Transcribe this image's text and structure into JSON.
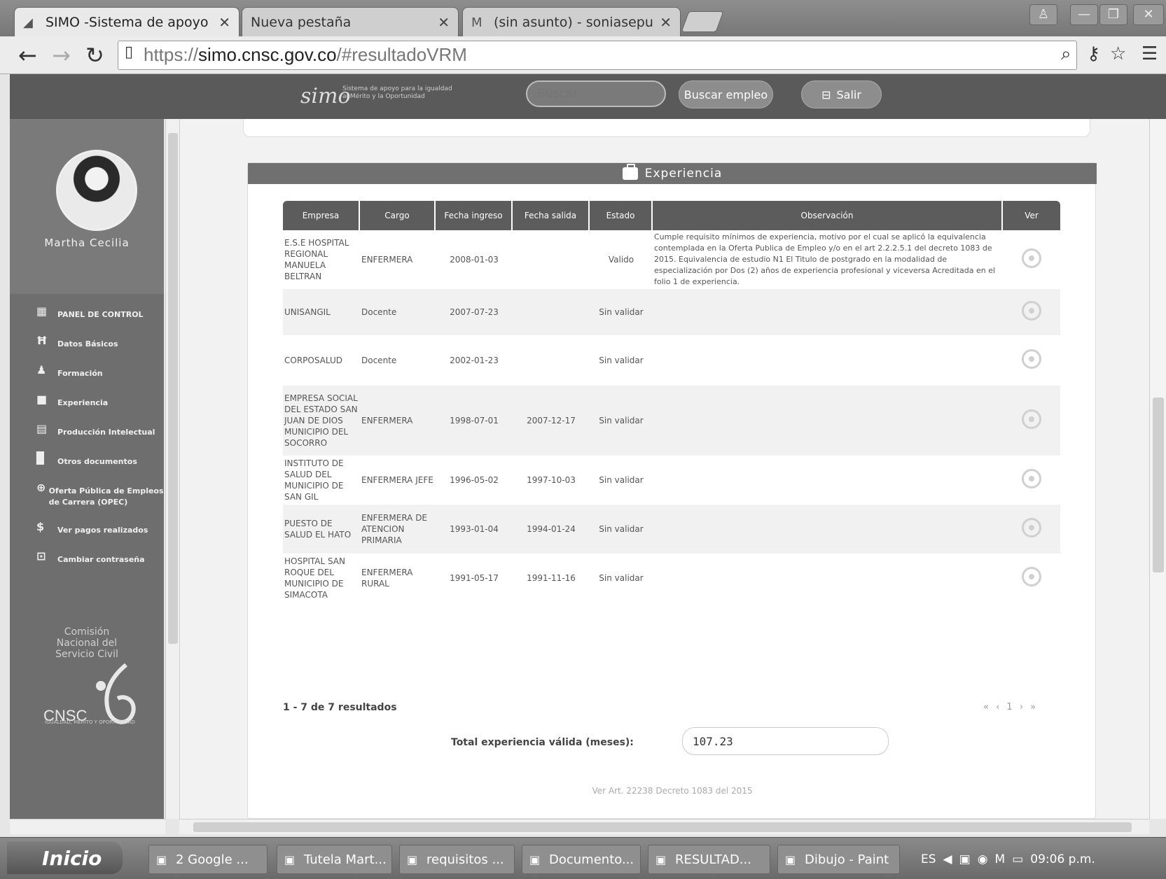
{
  "browser": {
    "tabs": [
      {
        "title": "SIMO -Sistema de apoyo pa",
        "active": true
      },
      {
        "title": "Nueva pestaña",
        "active": false
      },
      {
        "title": "(sin asunto) - soniasepulved",
        "active": false
      }
    ],
    "url_prefix": "https://",
    "url_host": "simo.cnsc.gov.co",
    "url_path": "/#resultadoVRM"
  },
  "header": {
    "logo": "simo",
    "logo_tagline": "Sistema de apoyo para la igualdad al Mérito y la Oportunidad",
    "search_placeholder": "Buscar",
    "search_button": "Buscar empleo",
    "logout_label": "Salir"
  },
  "sidebar": {
    "user_name": "Martha Cecilia",
    "menu": [
      {
        "label": "PANEL DE CONTROL",
        "icon": "dashboard-icon",
        "glyph": "▦"
      },
      {
        "label": "Datos Básicos",
        "icon": "user-data-icon",
        "glyph": "Ħ"
      },
      {
        "label": "Formación",
        "icon": "education-icon",
        "glyph": "♟"
      },
      {
        "label": "Experiencia",
        "icon": "briefcase-icon",
        "glyph": "■"
      },
      {
        "label": "Producción Intelectual",
        "icon": "book-icon",
        "glyph": "▤"
      },
      {
        "label": "Otros documentos",
        "icon": "document-icon",
        "glyph": "▉"
      },
      {
        "label": "Oferta Pública de Empleos de Carrera (OPEC)",
        "icon": "globe-icon",
        "glyph": "⊕"
      },
      {
        "label": "Ver pagos realizados",
        "icon": "dollar-icon",
        "glyph": "$"
      },
      {
        "label": "Cambiar contraseña",
        "icon": "lock-icon",
        "glyph": "⊡"
      }
    ],
    "org_name": "Comisión Nacional del Servicio Civil",
    "org_acronym": "CNSC",
    "org_motto": "IGUALDAD, MÉRITO Y OPORTUNIDAD"
  },
  "experience": {
    "section_title": "Experiencia",
    "columns": [
      "Empresa",
      "Cargo",
      "Fecha ingreso",
      "Fecha salida",
      "Estado",
      "Observación",
      "Ver"
    ],
    "rows": [
      {
        "empresa": "E.S.E HOSPITAL REGIONAL MANUELA BELTRAN",
        "cargo": "ENFERMERA",
        "ingreso": "2008-01-03",
        "salida": "",
        "estado": "Valido",
        "observacion": "Cumple requisito mínimos de experiencia, motivo por el cual se aplicó la equivalencia contemplada en la Oferta Publica de Empleo y/o en el art 2.2.2.5.1 del decreto 1083 de 2015. Equivalencia de estudio N1 El Titulo de postgrado en la modalidad de especialización por Dos (2) años de experiencia profesional y viceversa Acreditada en el folio 1 de experiencia."
      },
      {
        "empresa": "UNISANGIL",
        "cargo": "Docente",
        "ingreso": "2007-07-23",
        "salida": "",
        "estado": "Sin validar",
        "observacion": ""
      },
      {
        "empresa": "CORPOSALUD",
        "cargo": "Docente",
        "ingreso": "2002-01-23",
        "salida": "",
        "estado": "Sin validar",
        "observacion": ""
      },
      {
        "empresa": "EMPRESA SOCIAL DEL ESTADO SAN JUAN DE DIOS MUNICIPIO DEL SOCORRO",
        "cargo": "ENFERMERA",
        "ingreso": "1998-07-01",
        "salida": "2007-12-17",
        "estado": "Sin validar",
        "observacion": ""
      },
      {
        "empresa": "INSTITUTO DE SALUD DEL MUNICIPIO DE SAN GIL",
        "cargo": "ENFERMERA JEFE",
        "ingreso": "1996-05-02",
        "salida": "1997-10-03",
        "estado": "Sin validar",
        "observacion": ""
      },
      {
        "empresa": "PUESTO DE SALUD EL HATO",
        "cargo": "ENFERMERA DE ATENCION PRIMARIA",
        "ingreso": "1993-01-04",
        "salida": "1994-01-24",
        "estado": "Sin validar",
        "observacion": ""
      },
      {
        "empresa": "HOSPITAL SAN ROQUE DEL MUNICIPIO DE SIMACOTA",
        "cargo": "ENFERMERA RURAL",
        "ingreso": "1991-05-17",
        "salida": "1991-11-16",
        "estado": "Sin validar",
        "observacion": ""
      }
    ],
    "results_summary": "1 - 7 de 7 resultados",
    "pager": "« ‹ 1 › »",
    "total_label": "Total experiencia válida (meses):",
    "total_value": "107.23",
    "footnote": "Ver Art. 22238 Decreto 1083 del 2015"
  },
  "taskbar": {
    "start_label": "Inicio",
    "items": [
      {
        "label": "2 Google ..."
      },
      {
        "label": "Tutela Mart..."
      },
      {
        "label": "requisitos ..."
      },
      {
        "label": "Documento..."
      },
      {
        "label": "RESULTAD..."
      },
      {
        "label": "Dibujo - Paint"
      }
    ],
    "language": "ES",
    "clock": "09:06 p.m."
  }
}
